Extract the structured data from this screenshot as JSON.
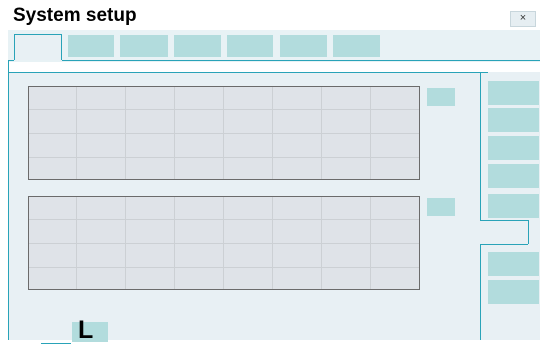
{
  "window": {
    "title": "System setup",
    "close_label": "×"
  },
  "tabs": [
    {
      "label": "",
      "active": true
    },
    {
      "label": "",
      "active": false
    },
    {
      "label": "",
      "active": false
    },
    {
      "label": "",
      "active": false
    },
    {
      "label": "",
      "active": false
    },
    {
      "label": "",
      "active": false
    },
    {
      "label": "",
      "active": false
    }
  ],
  "tables": [
    {
      "rows": 4,
      "columns": 8
    },
    {
      "rows": 4,
      "columns": 8
    }
  ],
  "table_buttons": [
    "",
    ""
  ],
  "side_buttons": [
    "",
    "",
    "",
    "",
    "",
    "",
    "",
    ""
  ],
  "bottom": {
    "label": "L"
  },
  "colors": {
    "accent": "#29a3b8",
    "button_fill": "#b2dcdd",
    "panel_bg": "#e8f0f4",
    "grid_bg": "#dfe3e8",
    "grid_lines": "#ccd0d4"
  }
}
